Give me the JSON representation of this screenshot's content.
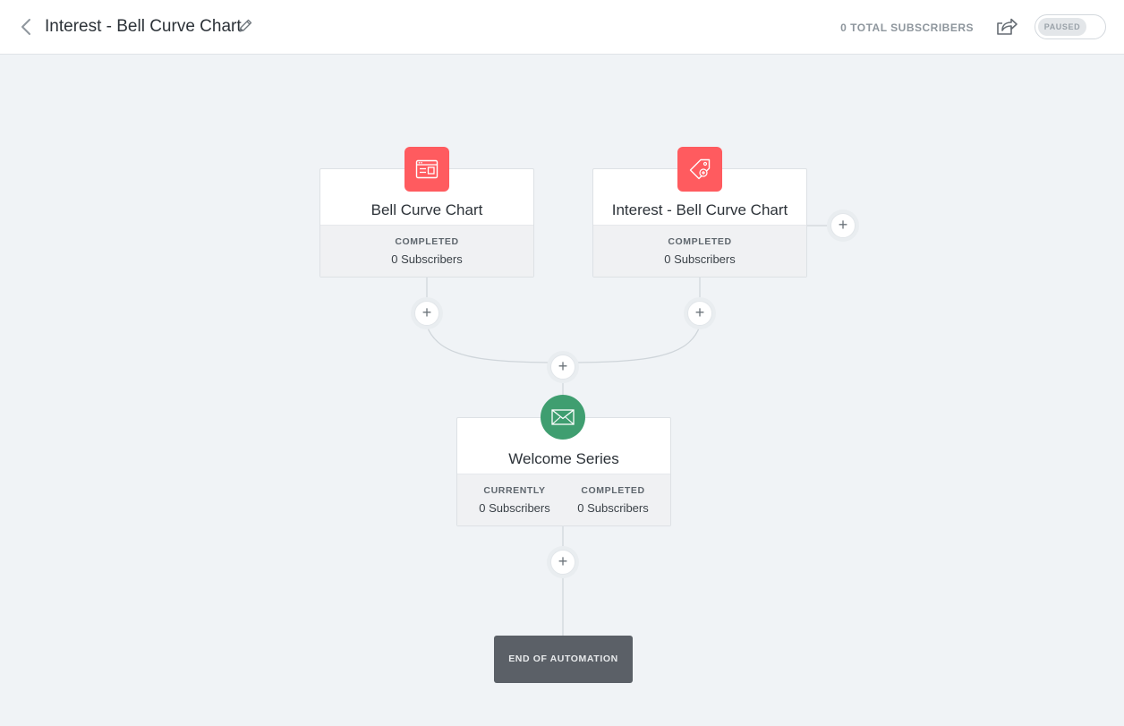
{
  "header": {
    "title": "Interest - Bell Curve Chart",
    "total_subscribers": "0 TOTAL SUBSCRIBERS",
    "status_toggle": "PAUSED"
  },
  "icons": {
    "back": "chevron-left-icon",
    "edit": "pencil-icon",
    "share": "share-icon",
    "form": "form-icon",
    "tag": "tag-icon",
    "email": "envelope-icon"
  },
  "colors": {
    "trigger_icon": "#ff5b5f",
    "email_icon": "#3f9e70",
    "end_box": "#5b6067",
    "canvas": "#f0f3f6"
  },
  "nodes": {
    "trigger1": {
      "title": "Bell Curve Chart",
      "stat_label": "COMPLETED",
      "stat_value": "0 Subscribers"
    },
    "trigger2": {
      "title": "Interest - Bell Curve Chart",
      "stat_label": "COMPLETED",
      "stat_value": "0 Subscribers"
    },
    "email": {
      "title": "Welcome Series",
      "currently_label": "CURRENTLY",
      "currently_value": "0 Subscribers",
      "completed_label": "COMPLETED",
      "completed_value": "0 Subscribers"
    }
  },
  "add_step_symbol": "+",
  "end": {
    "label": "END OF AUTOMATION"
  }
}
